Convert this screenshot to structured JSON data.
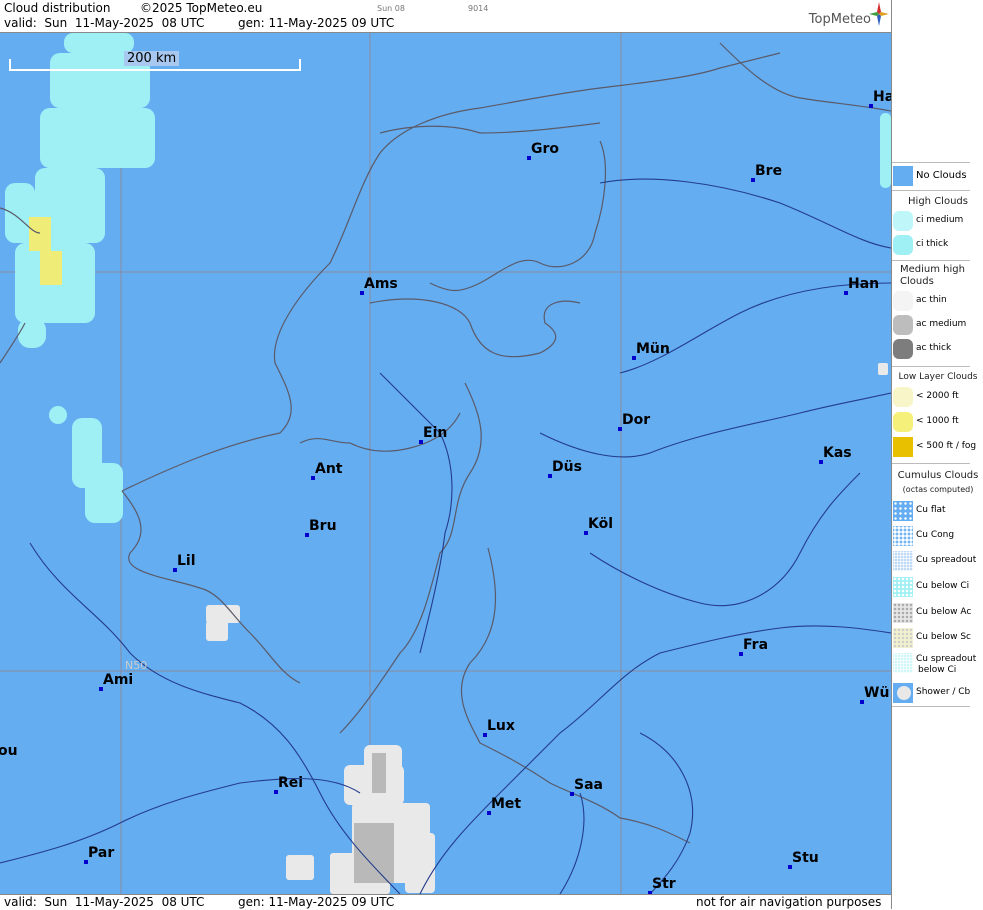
{
  "header": {
    "title": "Cloud distribution",
    "copyright": "©2025 TopMeteo.eu",
    "small1": "Sun 08",
    "small2": "9014",
    "valid": "valid:  Sun  11-May-2025  08 UTC",
    "gen": "gen: 11-May-2025 09 UTC",
    "logo": "TopMeteo"
  },
  "footer": {
    "valid": "valid:  Sun  11-May-2025  08 UTC",
    "gen": "gen: 11-May-2025 09 UTC",
    "notice": "not for air navigation purposes"
  },
  "scale": {
    "label": "200 km"
  },
  "lat_label": "N50",
  "cities": [
    {
      "name": "Gro"
    },
    {
      "name": "Bre"
    },
    {
      "name": "Ha"
    },
    {
      "name": "Ams"
    },
    {
      "name": "Han"
    },
    {
      "name": "Mün"
    },
    {
      "name": "Ein"
    },
    {
      "name": "Dor"
    },
    {
      "name": "Kas"
    },
    {
      "name": "Ant"
    },
    {
      "name": "Düs"
    },
    {
      "name": "Bru"
    },
    {
      "name": "Köl"
    },
    {
      "name": "Lil"
    },
    {
      "name": "Fra"
    },
    {
      "name": "Ami"
    },
    {
      "name": "Wü"
    },
    {
      "name": "Lux"
    },
    {
      "name": "ou"
    },
    {
      "name": "Rei"
    },
    {
      "name": "Saa"
    },
    {
      "name": "Met"
    },
    {
      "name": "Par"
    },
    {
      "name": "Stu"
    },
    {
      "name": "Str"
    }
  ],
  "legend": {
    "no_clouds": "No Clouds",
    "high_head": "High Clouds",
    "ci_medium": "ci medium",
    "ci_thick": "ci thick",
    "medium_head": "Medium high Clouds",
    "ac_thin": "ac thin",
    "ac_medium": "ac medium",
    "ac_thick": "ac thick",
    "low_head": "Low Layer Clouds",
    "low_2000": "< 2000 ft",
    "low_1000": "< 1000 ft",
    "low_500": "< 500 ft / fog",
    "cu_head": "Cumulus Clouds",
    "cu_sub": "(octas computed)",
    "cu_flat": "Cu flat",
    "cu_cong": "Cu Cong",
    "cu_spread": "Cu spreadout",
    "cu_below_ci": "Cu below Ci",
    "cu_below_ac": "Cu below Ac",
    "cu_below_sc": "Cu below Sc",
    "cu_spread_ci_1": "Cu spreadout",
    "cu_spread_ci_2": "below Ci",
    "shower": "Shower / Cb"
  },
  "colors": {
    "sea_land": "#64adf0",
    "ci_thick": "#9ff0f5",
    "low_1000": "#f5f07a",
    "cu_grey": "#e8e8e8",
    "city_dot": "#0000cc"
  }
}
